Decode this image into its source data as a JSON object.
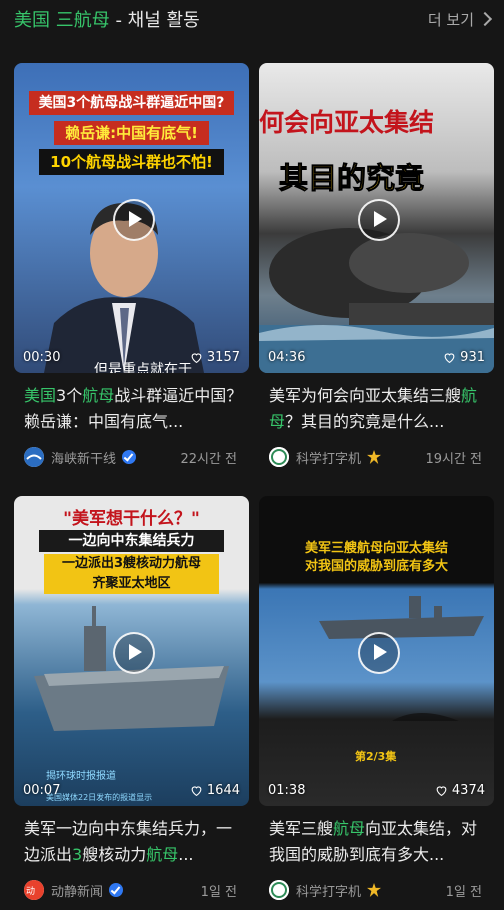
{
  "header": {
    "title_part1": "美国",
    "title_part2": "三航母",
    "title_suffix": " - 채널 활동",
    "more_label": "더 보기"
  },
  "cards": [
    {
      "thumb_text": [
        "美国3个航母战斗群逼近中国?",
        "赖岳谦:中国有底气!",
        "10个航母战斗群也不怕!",
        "但是重点就在于"
      ],
      "duration": "00:30",
      "likes": "3157",
      "title_pre": "",
      "title_hl1": "美国",
      "title_mid1": "3个",
      "title_hl2": "航母",
      "title_rest": "战斗群逼近中国？赖岳谦：中国有底气...",
      "channel": "海峡新干线",
      "time": "22시간 전"
    },
    {
      "thumb_text": [
        "何会向亚太集结",
        "其目的究竟"
      ],
      "duration": "04:36",
      "likes": "931",
      "title_pre": "美军为何会向亚太集结三艘",
      "title_hl": "航母",
      "title_rest": "？其目的究竟是什么...",
      "channel": "科学打字机",
      "time": "19시간 전"
    },
    {
      "thumb_text": [
        "\"美军想干什么？\"",
        "一边向中东集结兵力",
        "一边派出3艘核动力航母",
        "齐聚亚太地区",
        "揭环球时报报道",
        "美国媒体22日发布的报道显示"
      ],
      "duration": "00:07",
      "likes": "1644",
      "title_pre": "美军一边向中东集结兵力，一边派出",
      "title_hl1": "3",
      "title_mid": "艘核动力",
      "title_hl2": "航母",
      "title_rest": "...",
      "channel": "动静新闻",
      "time": "1일 전"
    },
    {
      "thumb_text": [
        "美军三艘航母向亚太集结",
        "对我国的威胁到底有多大",
        "第2/3集"
      ],
      "duration": "01:38",
      "likes": "4374",
      "title_pre": "美军三艘",
      "title_hl": "航母",
      "title_rest": "向亚太集结，对我国的威胁到底有多大...",
      "channel": "科学打字机",
      "time": "1일 전"
    }
  ],
  "colors": {
    "accent": "#37c56a",
    "background": "#161616",
    "verify": "#2f78f2",
    "gold": "#f1b927"
  },
  "icons": [
    "chevron-right-icon",
    "play-icon",
    "heart-icon",
    "verified-icon",
    "gold-badge-icon"
  ]
}
